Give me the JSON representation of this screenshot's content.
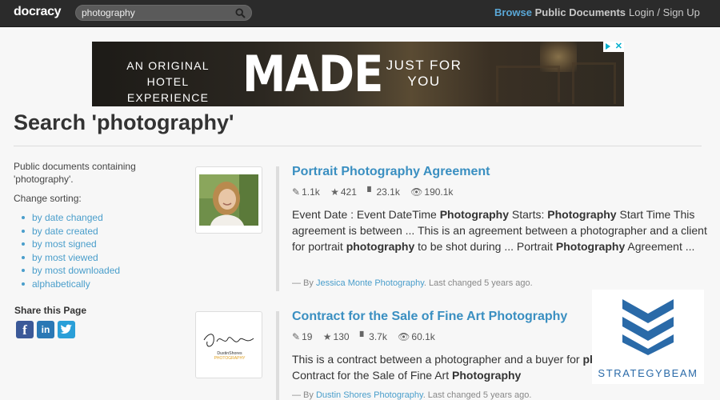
{
  "navbar": {
    "brand": "docracy",
    "search_value": "photography",
    "browse_prefix": "Browse",
    "browse_rest": "Public Documents",
    "login": "Login / Sign Up"
  },
  "ad": {
    "tagline": "AN ORIGINAL HOTEL EXPERIENCE",
    "headline": "MADE",
    "tagline2": "JUST FOR YOU"
  },
  "page": {
    "title": "Search 'photography'"
  },
  "sidebar": {
    "description": "Public documents containing 'photography'.",
    "sort_label": "Change sorting:",
    "sort_options": [
      "by date changed",
      "by date created",
      "by most signed",
      "by most viewed",
      "by most downloaded",
      "alphabetically"
    ],
    "share_title": "Share this Page",
    "share_icons": [
      "facebook-icon",
      "linkedin-icon",
      "twitter-icon"
    ]
  },
  "results": [
    {
      "title": "Portrait Photography Agreement",
      "stats": {
        "edits": "1.1k",
        "stars": "421",
        "downloads": "23.1k",
        "views": "190.1k"
      },
      "snippet_html": "Event Date : Event DateTime <b>Photography</b> Starts: <b>Photography</b> Start Time This agreement is between ... This is an agreement between a photographer and a client for portrait <b>photography</b> to be shot during ... Portrait <b>Photography</b> Agreement ...",
      "by_prefix": "— By",
      "author": "Jessica Monte Photography",
      "changed": ". Last changed 5 years ago."
    },
    {
      "title": "Contract for the Sale of Fine Art Photography",
      "stats": {
        "edits": "19",
        "stars": "130",
        "downloads": "3.7k",
        "views": "60.1k"
      },
      "snippet_html": "This is a contract between a photographer and a buyer for <b>photography</b> ... Contract for the Sale of Fine Art <b>Photography</b>",
      "by_prefix": "— By",
      "author": "Dustin Shores Photography",
      "changed": ". Last changed 5 years ago.",
      "thumb_logo_text_1": "DustinShores",
      "thumb_logo_text_2": "PHOTOGRAPHY"
    }
  ],
  "watermark": {
    "text": "STRATEGYBEAM"
  },
  "colors": {
    "link": "#4a9ecb",
    "title": "#3a8fc1",
    "navbar": "#2b2b2b",
    "watermark": "#2a6aa8"
  }
}
